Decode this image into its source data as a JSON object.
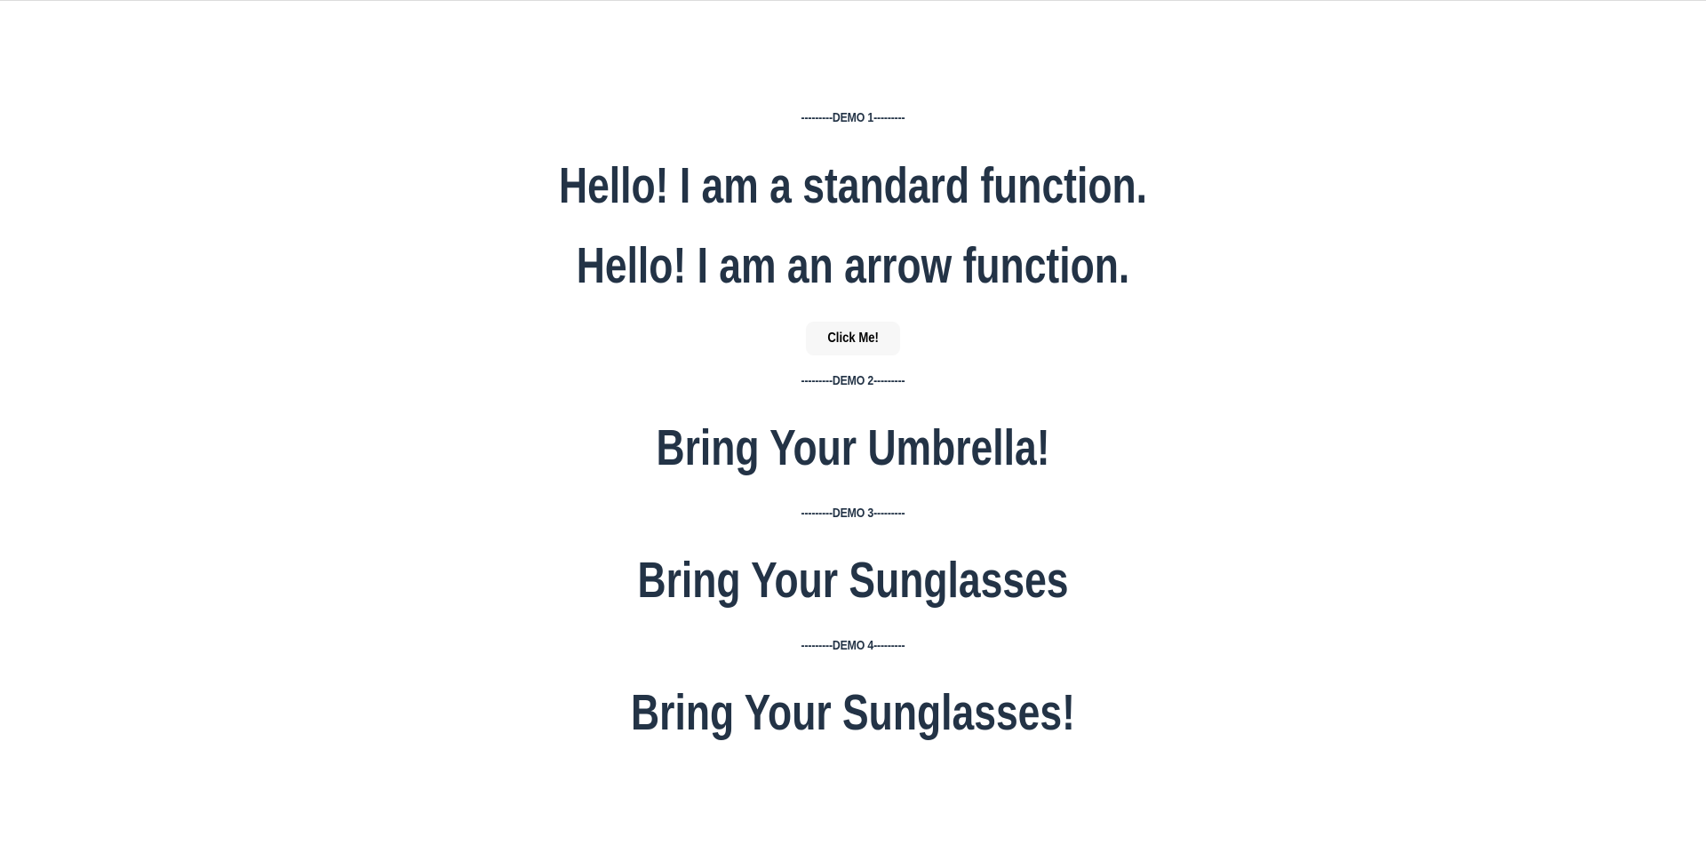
{
  "demos": [
    {
      "divider": "---------DEMO 1---------",
      "lines": [
        "Hello! I am a standard function.",
        "Hello! I am an arrow function."
      ],
      "button_label": "Click Me!"
    },
    {
      "divider": "---------DEMO 2---------",
      "lines": [
        "Bring Your Umbrella!"
      ]
    },
    {
      "divider": "---------DEMO 3---------",
      "lines": [
        "Bring Your Sunglasses"
      ]
    },
    {
      "divider": "---------DEMO 4---------",
      "lines": [
        "Bring Your Sunglasses!"
      ]
    }
  ],
  "colors": {
    "text": "#233346",
    "button_bg": "#f7f7f7",
    "background": "#ffffff"
  }
}
